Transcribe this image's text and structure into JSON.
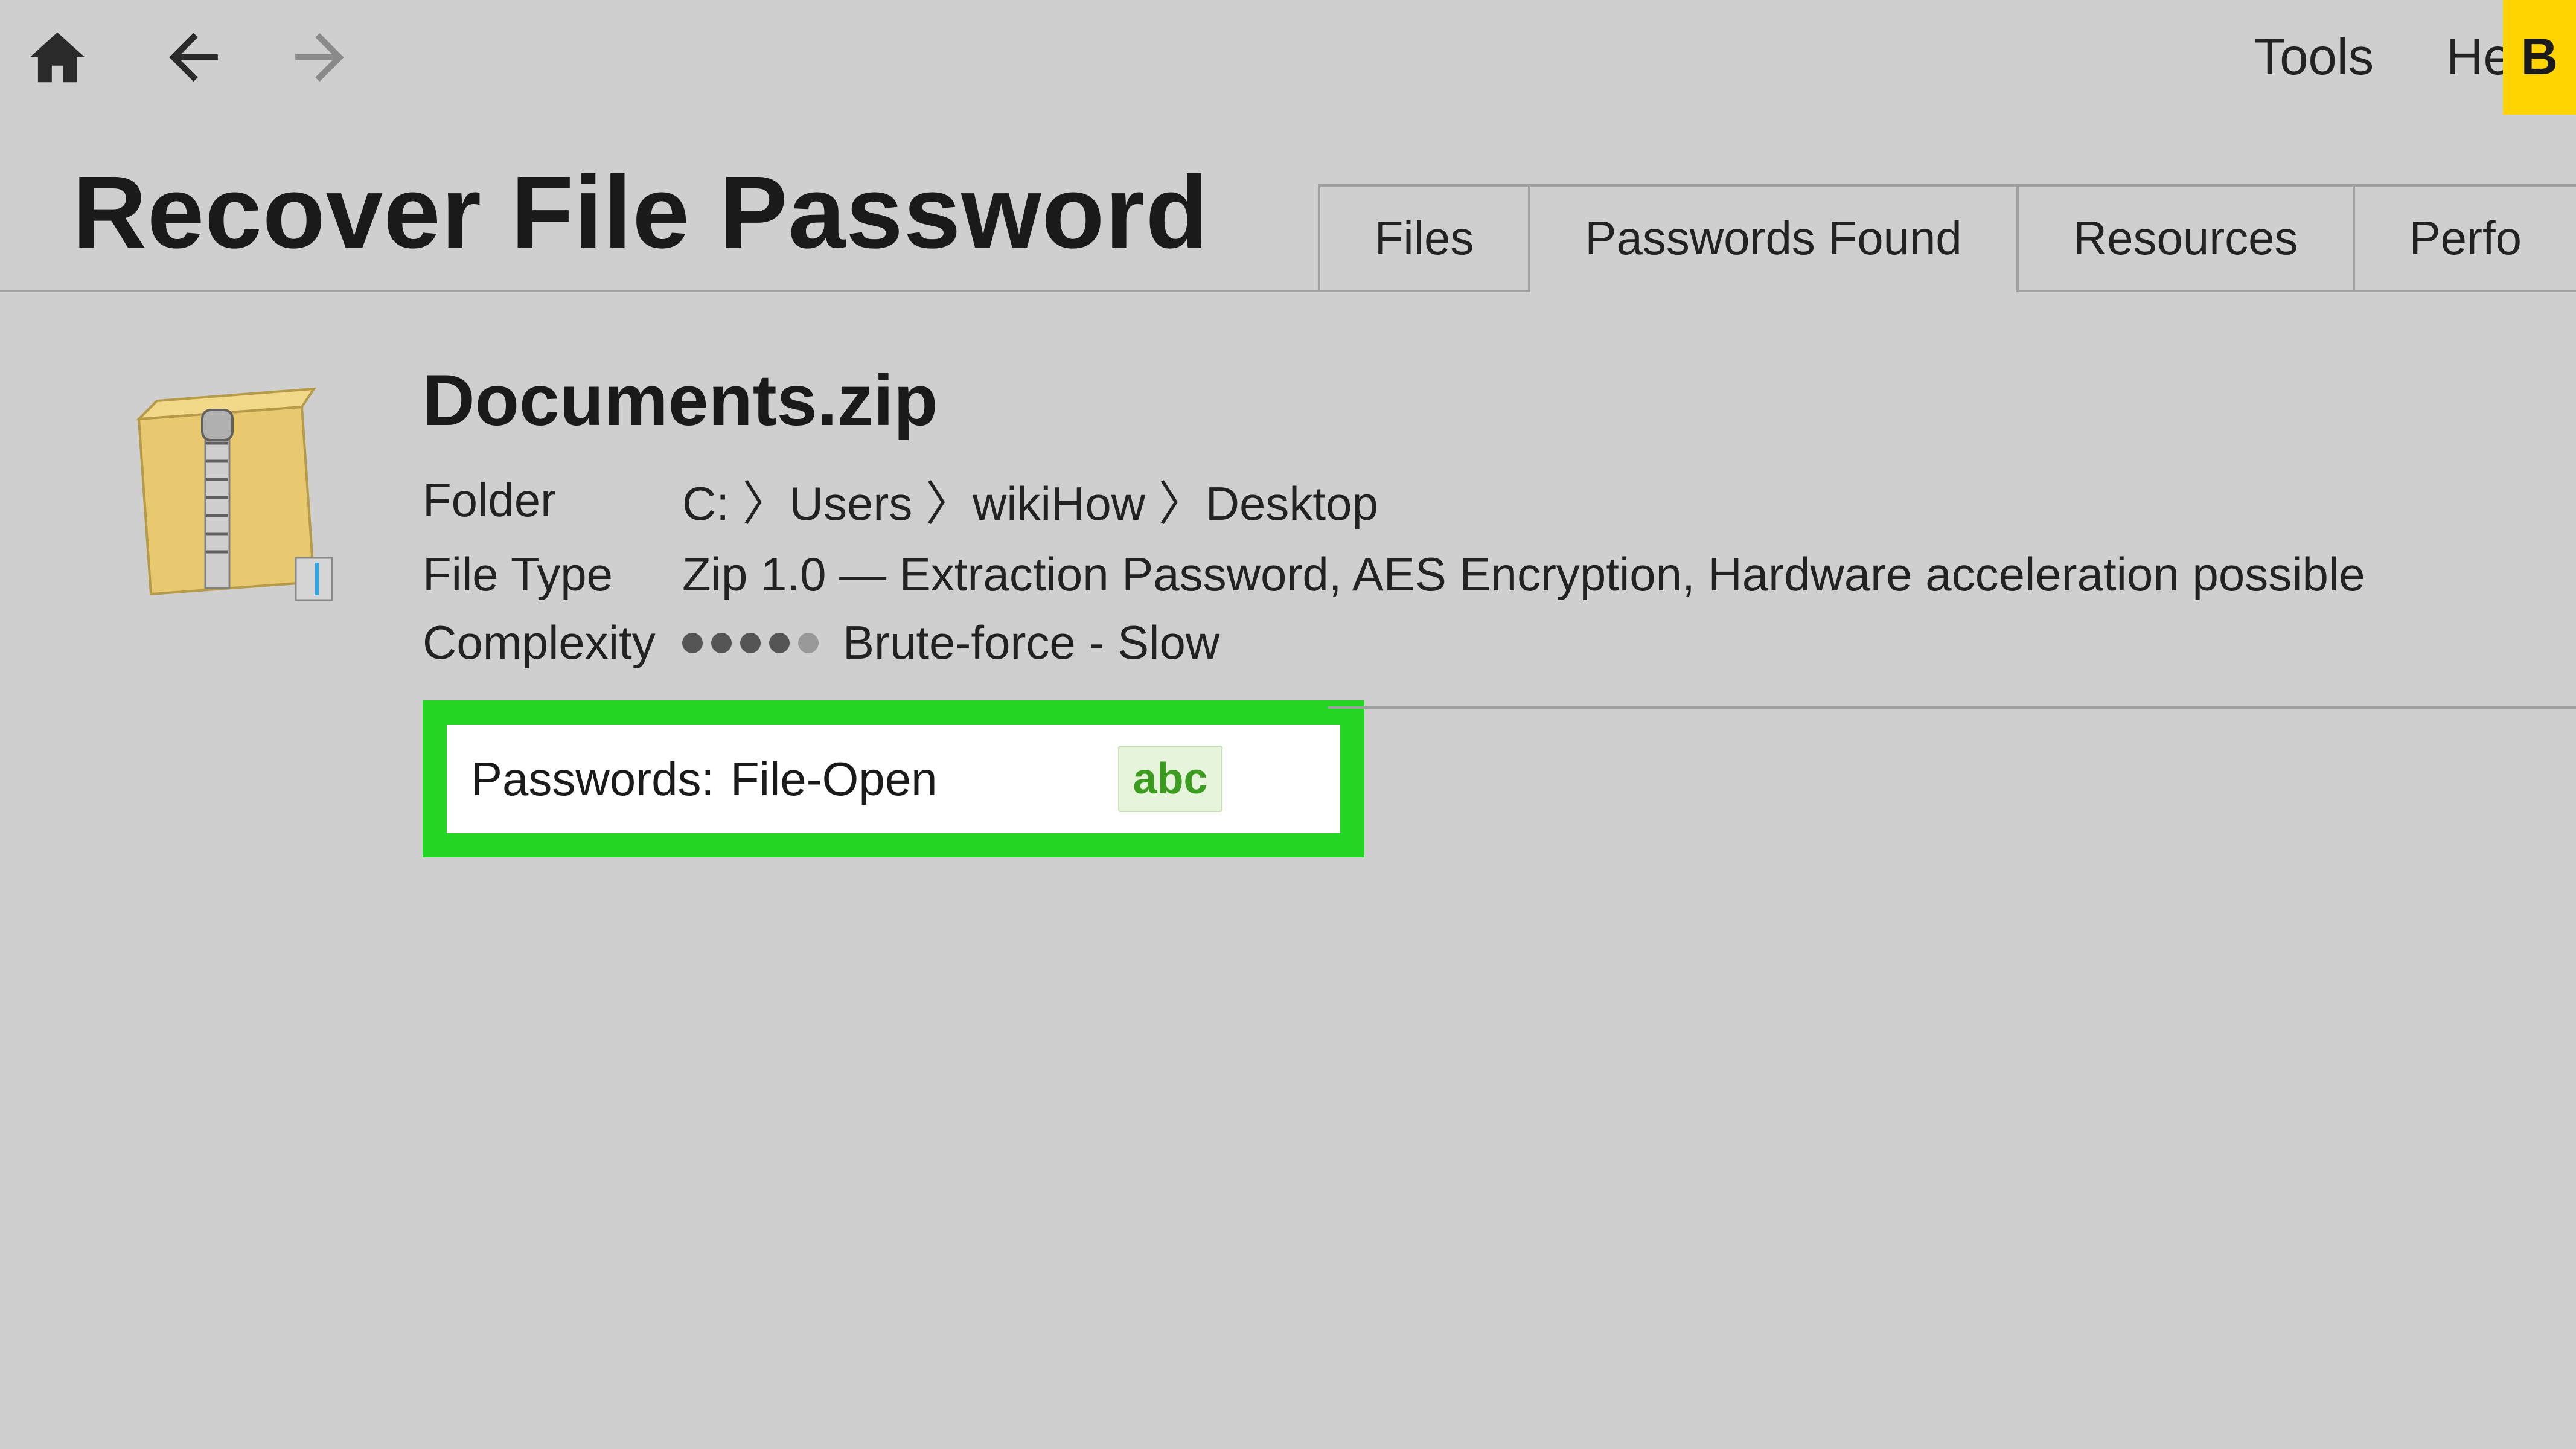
{
  "menu": {
    "tools": "Tools",
    "help": "Help",
    "buy_partial": "B"
  },
  "page": {
    "title": "Recover File Password"
  },
  "tabs": {
    "files": "Files",
    "passwords_found": "Passwords Found",
    "resources": "Resources",
    "performance_partial": "Perfo"
  },
  "file": {
    "name": "Documents.zip",
    "folder_label": "Folder",
    "folder_value": "C: 〉Users 〉wikiHow 〉Desktop",
    "filetype_label": "File Type",
    "filetype_value": "Zip 1.0 — Extraction Password, AES Encryption, Hardware acceleration possible",
    "complexity_label": "Complexity",
    "complexity_value": "Brute-force - Slow",
    "complexity_dots_filled": 4,
    "complexity_dots_total": 5
  },
  "passwords": {
    "label": "Passwords:",
    "value": "File-Open",
    "badge": "abc"
  },
  "colors": {
    "highlight_green": "#25d625",
    "badge_bg": "#e6f4dc",
    "badge_fg": "#3c9c20",
    "buy_yellow": "#ffd400"
  }
}
